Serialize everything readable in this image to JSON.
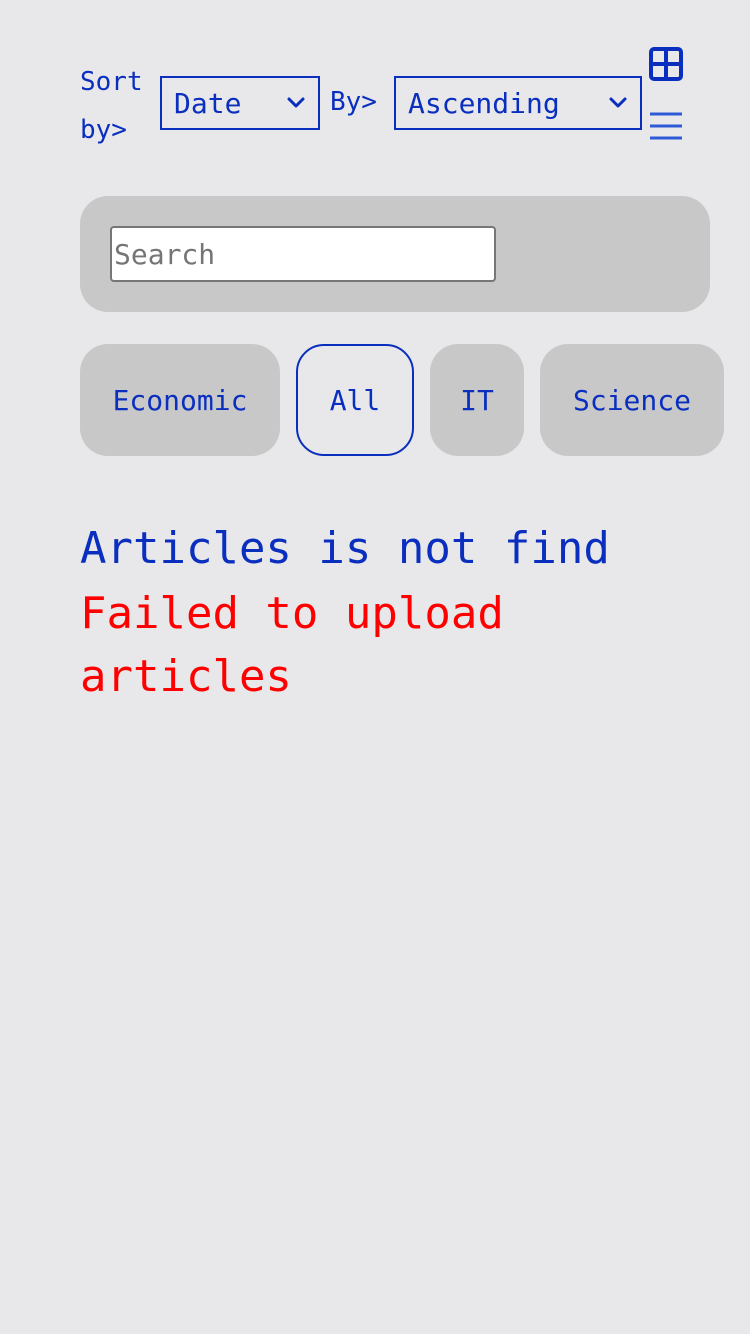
{
  "sort": {
    "label": "Sort by>",
    "field_value": "Date",
    "by_label": "By>",
    "order_value": "Ascending"
  },
  "view_toggle": {
    "grid_icon": "grid-view-icon",
    "list_icon": "list-view-icon"
  },
  "search": {
    "placeholder": "Search",
    "value": ""
  },
  "categories": [
    {
      "label": "Economic",
      "active": false
    },
    {
      "label": "All",
      "active": true
    },
    {
      "label": "IT",
      "active": false
    },
    {
      "label": "Science",
      "active": false
    }
  ],
  "messages": {
    "not_found": "Articles is not find",
    "error": "Failed to upload articles"
  },
  "colors": {
    "accent": "#0a2fbf",
    "error": "#ff0000",
    "background": "#e8e8ea",
    "panel": "#c8c8c8"
  }
}
